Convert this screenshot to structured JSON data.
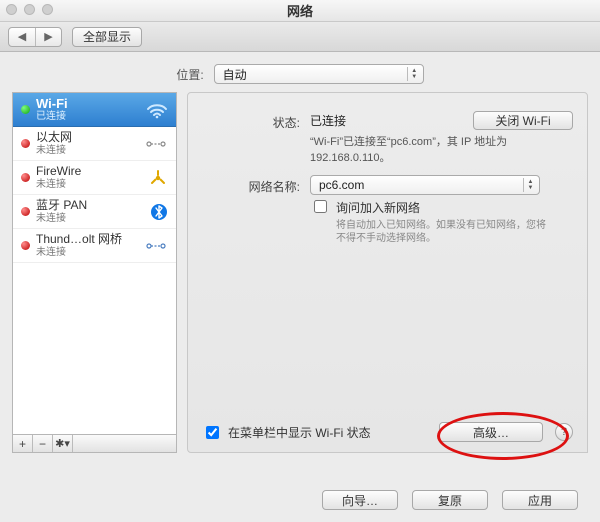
{
  "window": {
    "title": "网络"
  },
  "toolbar": {
    "show_all": "全部显示"
  },
  "location": {
    "label": "位置:",
    "value": "自动"
  },
  "sidebar": {
    "items": [
      {
        "name": "Wi-Fi",
        "status": "已连接",
        "status_kind": "green",
        "icon": "wifi",
        "selected": true
      },
      {
        "name": "以太网",
        "status": "未连接",
        "status_kind": "red",
        "icon": "ethernet"
      },
      {
        "name": "FireWire",
        "status": "未连接",
        "status_kind": "red",
        "icon": "firewire"
      },
      {
        "name": "蓝牙 PAN",
        "status": "未连接",
        "status_kind": "red",
        "icon": "bluetooth"
      },
      {
        "name": "Thund…olt 网桥",
        "status": "未连接",
        "status_kind": "red",
        "icon": "thunderbolt"
      }
    ]
  },
  "detail": {
    "status_label": "状态:",
    "status_value": "已连接",
    "turn_off_btn": "关闭 Wi-Fi",
    "status_note": "“Wi-Fi”已连接至“pc6.com”，其 IP 地址为 192.168.0.110。",
    "network_name_label": "网络名称:",
    "network_name_value": "pc6.com",
    "ask_to_join_label": "询问加入新网络",
    "ask_hint": "将自动加入已知网络。如果没有已知网络，您将不得不手动选择网络。",
    "show_menu_label": "在菜单栏中显示 Wi-Fi 状态",
    "advanced_btn": "高级…",
    "help": "?"
  },
  "buttons": {
    "assist": "向导…",
    "revert": "复原",
    "apply": "应用"
  }
}
